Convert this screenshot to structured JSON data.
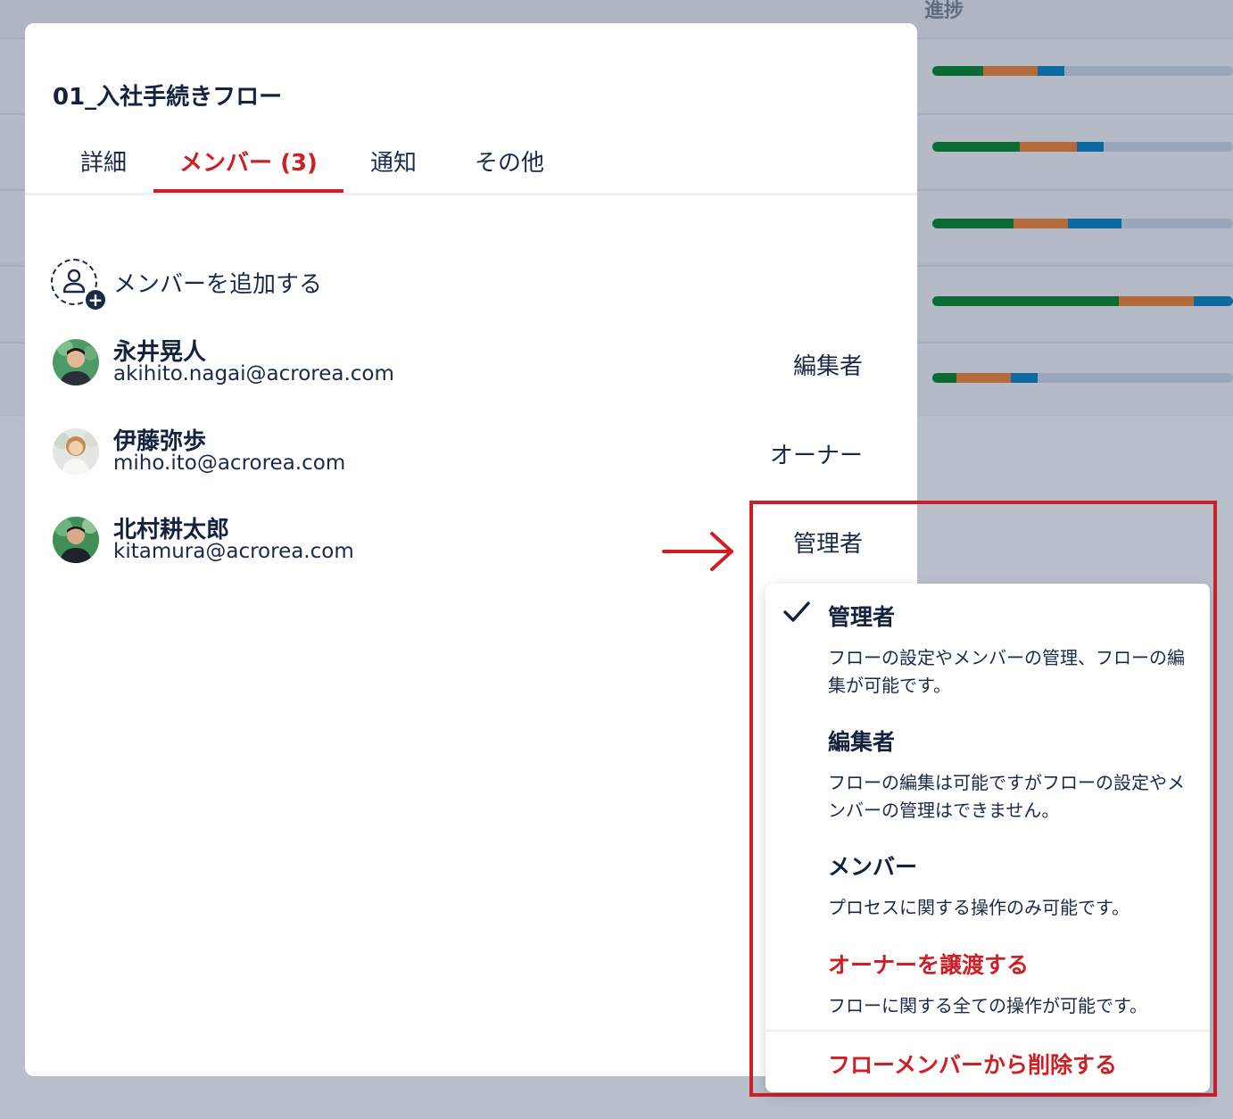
{
  "background": {
    "progress_header": "進捗",
    "progress_rows": [
      {
        "green": 0.17,
        "orange": 0.18,
        "blue": 0.09
      },
      {
        "green": 0.29,
        "orange": 0.19,
        "blue": 0.09
      },
      {
        "green": 0.27,
        "orange": 0.18,
        "blue": 0.18
      },
      {
        "green": 0.62,
        "orange": 0.25,
        "blue": 0.13
      },
      {
        "green": 0.08,
        "orange": 0.18,
        "blue": 0.09
      }
    ]
  },
  "dialog": {
    "title": "01_入社手続きフロー",
    "tabs": [
      {
        "label": "詳細",
        "active": false
      },
      {
        "label": "メンバー (3)",
        "active": true
      },
      {
        "label": "通知",
        "active": false
      },
      {
        "label": "その他",
        "active": false
      }
    ],
    "add_member_label": "メンバーを追加する",
    "members": [
      {
        "name": "永井晃人",
        "email": "akihito.nagai@acrorea.com",
        "role": "編集者"
      },
      {
        "name": "伊藤弥歩",
        "email": "miho.ito@acrorea.com",
        "role": "オーナー"
      },
      {
        "name": "北村耕太郎",
        "email": "kitamura@acrorea.com",
        "role": "管理者"
      }
    ]
  },
  "role_menu": {
    "options": [
      {
        "title": "管理者",
        "desc": "フローの設定やメンバーの管理、フローの編集が可能です。",
        "selected": true
      },
      {
        "title": "編集者",
        "desc": "フローの編集は可能ですがフローの設定やメンバーの管理はできません。",
        "selected": false
      },
      {
        "title": "メンバー",
        "desc": "プロセスに関する操作のみ可能です。",
        "selected": false
      },
      {
        "title": "オーナーを譲渡する",
        "desc": "フローに関する全ての操作が可能です。",
        "selected": false
      }
    ],
    "remove_label": "フローメンバーから削除する"
  },
  "colors": {
    "accent": "#cc2027",
    "text": "#1b2a4a",
    "progress_green": "#0b6b33",
    "progress_orange": "#b56a3c",
    "progress_blue": "#0d6aa0"
  }
}
